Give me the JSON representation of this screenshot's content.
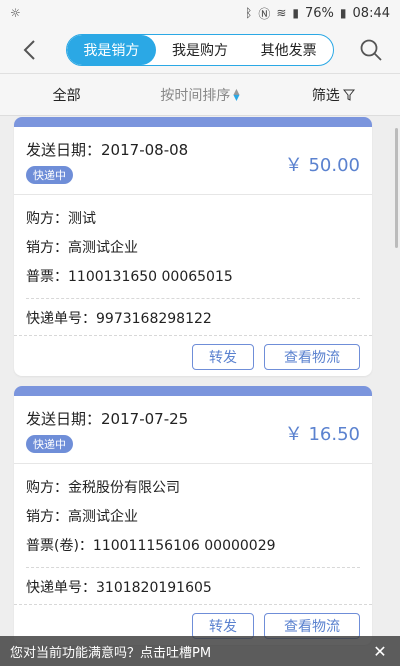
{
  "status_bar": {
    "battery": "76%",
    "time": "08:44"
  },
  "tabs": [
    {
      "label": "我是销方",
      "active": true
    },
    {
      "label": "我是购方",
      "active": false
    },
    {
      "label": "其他发票",
      "active": false
    }
  ],
  "filters": {
    "all": "全部",
    "sort": "按时间排序",
    "filter": "筛选"
  },
  "invoices": [
    {
      "date_label": "发送日期：",
      "date": "2017-08-08",
      "status": "快递中",
      "amount": "￥ 50.00",
      "buyer": "购方：测试",
      "seller": "销方：高测试企业",
      "invoice": "普票：1100131650 00065015",
      "express": "快递单号：9973168298122",
      "forward": "转发",
      "logistics": "查看物流"
    },
    {
      "date_label": "发送日期：",
      "date": "2017-07-25",
      "status": "快递中",
      "amount": "￥ 16.50",
      "buyer": "购方：金税股份有限公司",
      "seller": "销方：高测试企业",
      "invoice": "普票(卷)：110011156106 00000029",
      "express": "快递单号：3101820191605",
      "forward": "转发",
      "logistics": "查看物流"
    }
  ],
  "feedback": {
    "text": "您对当前功能满意吗？点击吐槽PM",
    "close": "✕"
  },
  "colors": {
    "accent": "#2ba8e5",
    "card_top": "#7b95dd",
    "amount": "#5b82cf"
  }
}
